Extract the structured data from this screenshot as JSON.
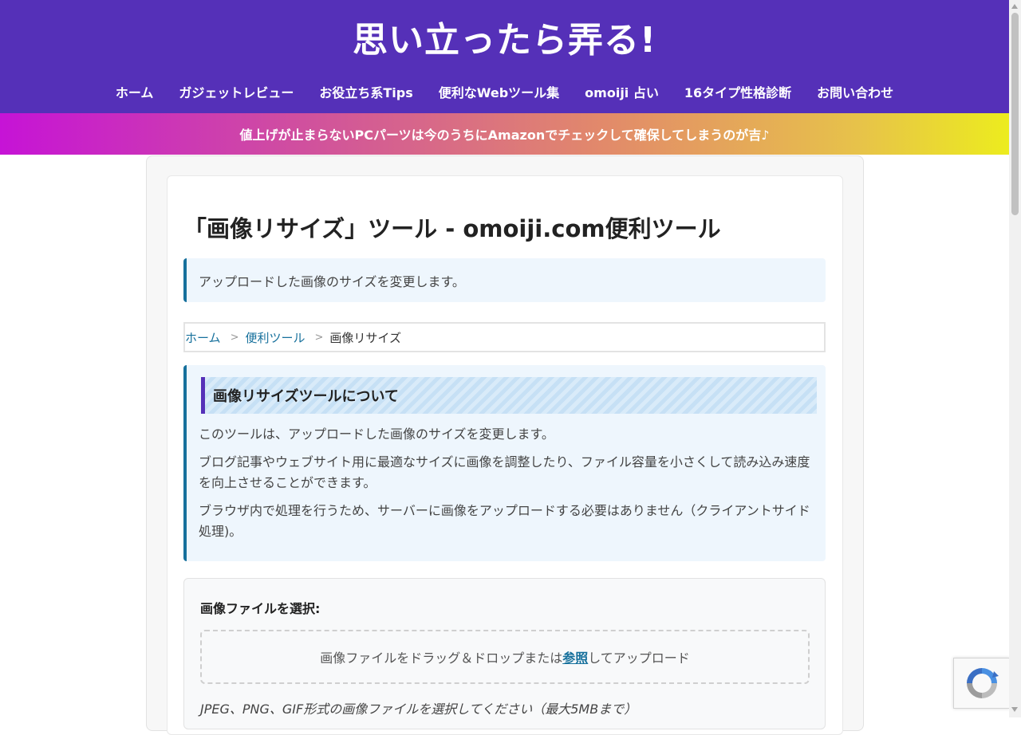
{
  "site": {
    "title": "思い立ったら弄る!"
  },
  "nav": [
    {
      "label": "ホーム"
    },
    {
      "label": "ガジェットレビュー"
    },
    {
      "label": "お役立ち系Tips"
    },
    {
      "label": "便利なWebツール集"
    },
    {
      "label": "omoiji 占い"
    },
    {
      "label": "16タイプ性格診断"
    },
    {
      "label": "お問い合わせ"
    }
  ],
  "banner": {
    "text": "値上げが止まらないPCパーツは今のうちにAmazonでチェックして確保してしまうのが吉♪"
  },
  "page": {
    "title": "「画像リサイズ」ツール - omoiji.com便利ツール",
    "lead": "アップロードした画像のサイズを変更します。"
  },
  "breadcrumb": {
    "home": "ホーム",
    "sep": ">",
    "category": "便利ツール",
    "current": "画像リサイズ"
  },
  "about": {
    "heading": "画像リサイズツールについて",
    "p1": "このツールは、アップロードした画像のサイズを変更します。",
    "p2_line1": "ブログ記事やウェブサイト用に最適なサイズに画像を調整したり、ファイル容量を小さくして読み込み速度",
    "p2_line2": "を向上させることができます。",
    "p3_line1": "ブラウザ内で処理を行うため、サーバーに画像をアップロードする必要はありません（クライアントサイド",
    "p3_line2": "処理)。"
  },
  "upload": {
    "label": "画像ファイルを選択:",
    "drop_before": "画像ファイルをドラッグ＆ドロップまたは",
    "browse": "参照",
    "drop_after": "してアップロード",
    "hint": "JPEG、PNG、GIF形式の画像ファイルを選択してください（最大5MBまで）"
  },
  "icons": {
    "recaptcha": "recaptcha-icon"
  },
  "colors": {
    "header": "#5530b8",
    "accent": "#16709c"
  }
}
